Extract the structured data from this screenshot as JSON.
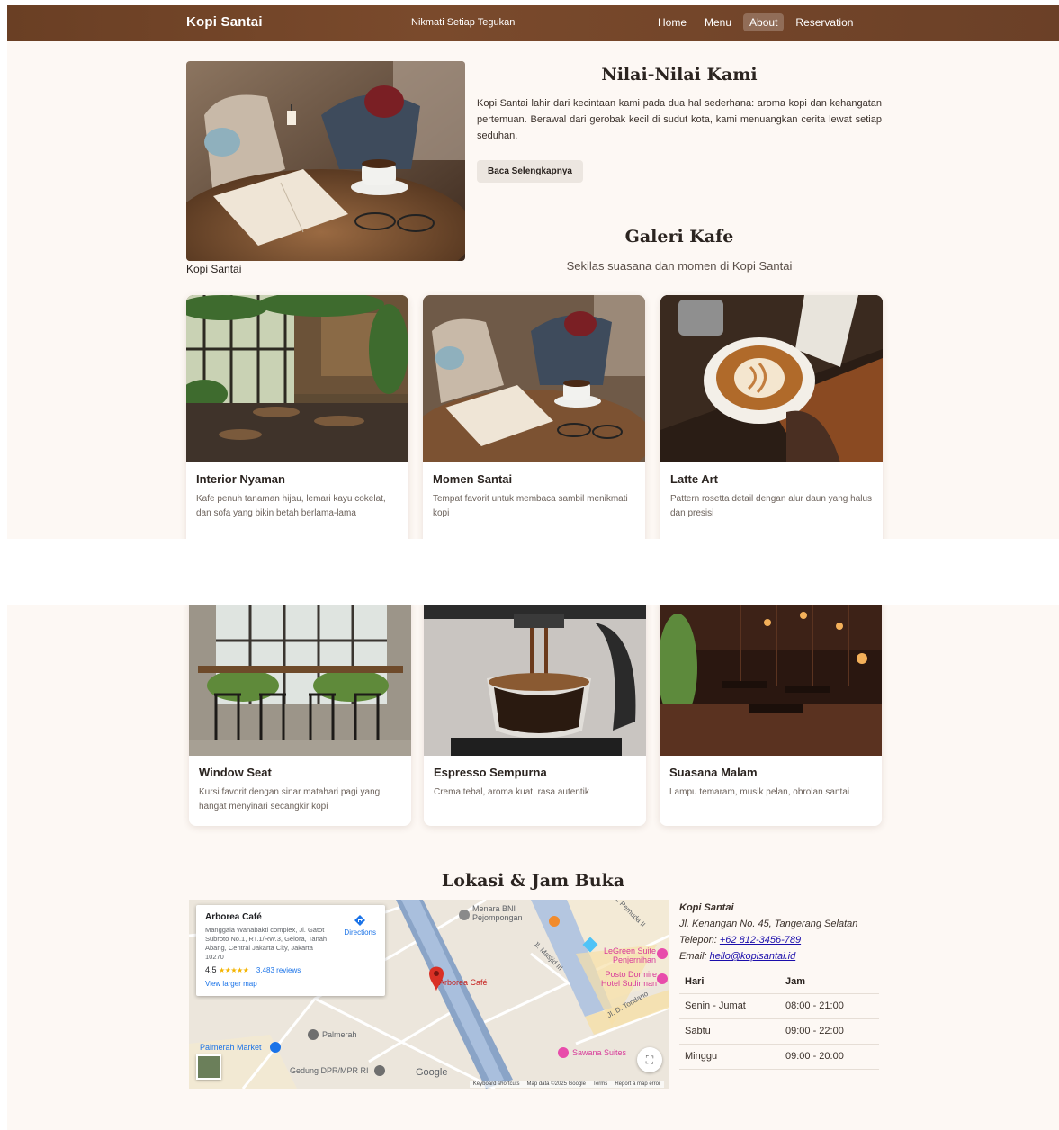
{
  "nav": {
    "brand": "Kopi Santai",
    "tagline": "Nikmati Setiap Tegukan",
    "links": [
      {
        "label": "Home",
        "active": false
      },
      {
        "label": "Menu",
        "active": false
      },
      {
        "label": "About",
        "active": true
      },
      {
        "label": "Reservation",
        "active": false
      }
    ]
  },
  "about": {
    "caption": "Kopi Santai",
    "title": "Nilai-Nilai Kami",
    "text": "Kopi Santai lahir dari kecintaan kami pada dua hal sederhana: aroma kopi dan kehangatan pertemuan. Berawal dari gerobak kecil di sudut kota, kami menuangkan cerita lewat setiap seduhan.",
    "button": "Baca Selengkapnya"
  },
  "gallery": {
    "title": "Galeri Kafe",
    "subtitle": "Sekilas suasana dan momen di Kopi Santai",
    "cards": [
      {
        "title": "Interior Nyaman",
        "desc": "Kafe penuh tanaman hijau, lemari kayu cokelat, dan sofa yang bikin betah berlama-lama"
      },
      {
        "title": "Momen Santai",
        "desc": "Tempat favorit untuk membaca sambil menikmati kopi"
      },
      {
        "title": "Latte Art",
        "desc": "Pattern rosetta detail dengan alur daun yang halus dan presisi"
      },
      {
        "title": "Window Seat",
        "desc": "Kursi favorit dengan sinar matahari pagi yang hangat menyinari secangkir kopi"
      },
      {
        "title": "Espresso Sempurna",
        "desc": "Crema tebal, aroma kuat, rasa autentik"
      },
      {
        "title": "Suasana Malam",
        "desc": "Lampu temaram, musik pelan, obrolan santai"
      }
    ]
  },
  "location": {
    "title": "Lokasi & Jam Buka",
    "map": {
      "place_name": "Arborea Café",
      "address": "Manggala Wanabakti complex, Jl. Gatot Subroto No.1, RT.1/RW.3, Gelora, Tanah Abang, Central Jakarta City, Jakarta 10270",
      "rating": "4.5",
      "stars": "★★★★★",
      "reviews": "3,483 reviews",
      "directions": "Directions",
      "view_larger": "View larger map",
      "labels": {
        "bni": "Menara BNI Pejompongan",
        "legreen": "LeGreen Suite Penjernihan",
        "posto": "Posto Dormire Hotel Sudirman",
        "arborea": "Arborea Café",
        "masjid": "Jl. Masjid III",
        "tondano": "Jl. D. Tondano",
        "palmerah": "Palmerah",
        "palmerah_market": "Palmerah Market",
        "dpr": "Gedung DPR/MPR RI",
        "sawana": "Sawana Suites",
        "pemuda": "Jl. Pemuda II",
        "google": "Google"
      },
      "footer": [
        "Keyboard shortcuts",
        "Map data ©2025 Google",
        "Terms",
        "Report a map error"
      ]
    },
    "contact": {
      "name": "Kopi Santai",
      "address": "Jl. Kenangan No. 45, Tangerang Selatan",
      "phone_label": "Telepon:",
      "phone": "+62 812-3456-789",
      "email_label": "Email:",
      "email": "hello@kopisantai.id"
    },
    "hours": {
      "headers": [
        "Hari",
        "Jam"
      ],
      "rows": [
        [
          "Senin - Jumat",
          "08:00 - 21:00"
        ],
        [
          "Sabtu",
          "09:00 - 22:00"
        ],
        [
          "Minggu",
          "09:00 - 20:00"
        ]
      ]
    }
  },
  "colors": {
    "nav_bg": "#6a3f24",
    "page_bg": "#fdf8f4",
    "card_bg": "#ffffff",
    "accent_text": "#2b2420"
  }
}
